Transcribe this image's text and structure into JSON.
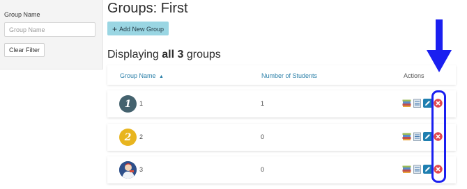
{
  "sidebar": {
    "filter_label": "Group Name",
    "filter_placeholder": "Group Name",
    "filter_value": "",
    "clear_label": "Clear Filter"
  },
  "page": {
    "title": "Groups: First",
    "add_label": "Add New Group",
    "displaying_prefix": "Displaying ",
    "displaying_bold": "all 3",
    "displaying_suffix": " groups"
  },
  "table": {
    "columns": {
      "name": "Group Name",
      "count": "Number of Students",
      "actions": "Actions"
    },
    "sort_indicator": "▲",
    "rows": [
      {
        "avatar": "1",
        "name": "1",
        "students": "1"
      },
      {
        "avatar": "2",
        "name": "2",
        "students": "0"
      },
      {
        "avatar": "",
        "name": "3",
        "students": "0"
      }
    ]
  },
  "icons": {
    "add": "plus-icon",
    "sort": "sort-up-icon",
    "books": "books-icon",
    "roster": "roster-icon",
    "edit": "edit-icon",
    "delete": "delete-icon",
    "annotation": "down-arrow-icon"
  },
  "colors": {
    "accent": "#9ad6e3",
    "link": "#2a7fa8",
    "edit": "#1f7fb0",
    "delete": "#e0484f",
    "annotation": "#1a1ff0"
  }
}
